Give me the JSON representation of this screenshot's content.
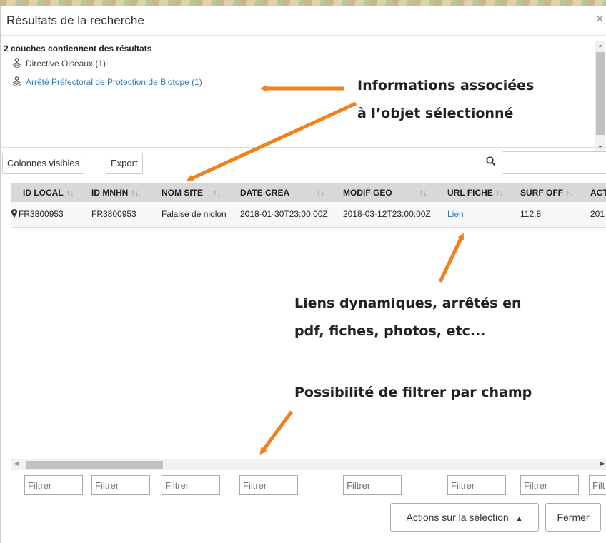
{
  "dialog": {
    "title": "Résultats de la recherche",
    "close_glyph": "×"
  },
  "layers": {
    "heading": "2 couches contiennent des résultats",
    "items": [
      {
        "label": "Directive Oiseaux (1)",
        "active": false
      },
      {
        "label": "Arrêté Préfectoral de Protection de Biotope (1)",
        "active": true
      }
    ]
  },
  "toolbar": {
    "columns_label": "Colonnes visibles",
    "export_label": "Export",
    "search_placeholder": ""
  },
  "table": {
    "columns": [
      "ID LOCAL",
      "ID MNHN",
      "NOM SITE",
      "DATE CREA",
      "MODIF GEO",
      "URL FICHE",
      "SURF OFF",
      "ACT"
    ],
    "sort_glyph": "↑↓",
    "rows": [
      [
        "FR3800953",
        "FR3800953",
        "Falaise de niolon",
        "2018-01-30T23:00:00Z",
        "2018-03-12T23:00:00Z",
        "Lien",
        "112.8",
        "201"
      ]
    ],
    "filter_placeholder": "Filtrer",
    "filter_last_value": "Filt"
  },
  "footer": {
    "actions_label": "Actions sur la sélection",
    "actions_caret": "▲",
    "close_label": "Fermer"
  },
  "annotations": {
    "info_line1": "Informations associées",
    "info_line2": "à l’objet sélectionné",
    "links_line1": "Liens dynamiques, arrêtés en",
    "links_line2": "pdf, fiches, photos, etc...",
    "filter_note": "Possibilité de filtrer par champ"
  },
  "colors": {
    "arrow": "#f0821e",
    "link": "#337ab7",
    "header_bg": "#d8d8d8"
  }
}
